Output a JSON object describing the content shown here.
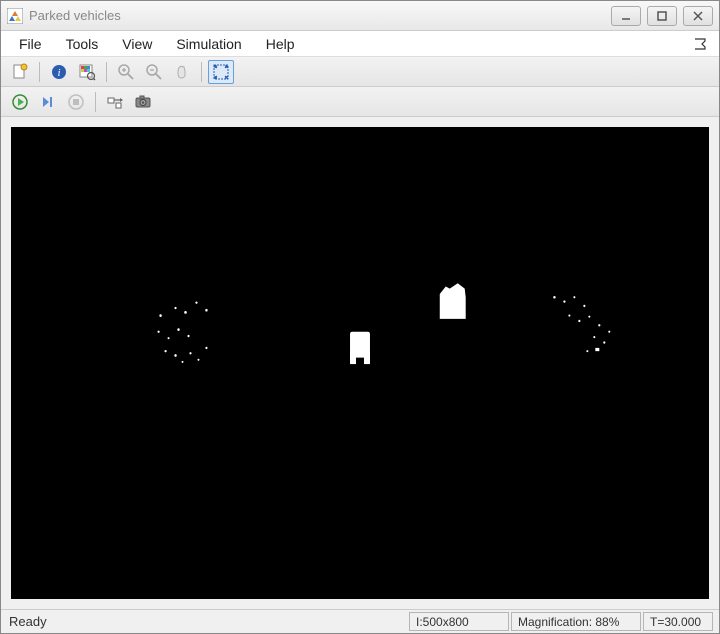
{
  "title": "Parked vehicles",
  "menu": {
    "file": "File",
    "tools": "Tools",
    "view": "View",
    "simulation": "Simulation",
    "help": "Help"
  },
  "toolbar": {
    "new_fig": "new-figure",
    "info": "info",
    "pixel_region": "pixel-region",
    "zoom_in": "zoom-in",
    "zoom_out": "zoom-out",
    "pan": "pan",
    "fit": "fit-to-window"
  },
  "toolbar2": {
    "play": "play",
    "step": "step",
    "stop": "stop",
    "highlight": "highlight-block",
    "snapshot": "snapshot"
  },
  "status": {
    "ready": "Ready",
    "image_size": "I:500x800",
    "mag_label": "Magnification: 88%",
    "time": "T=30.000"
  }
}
